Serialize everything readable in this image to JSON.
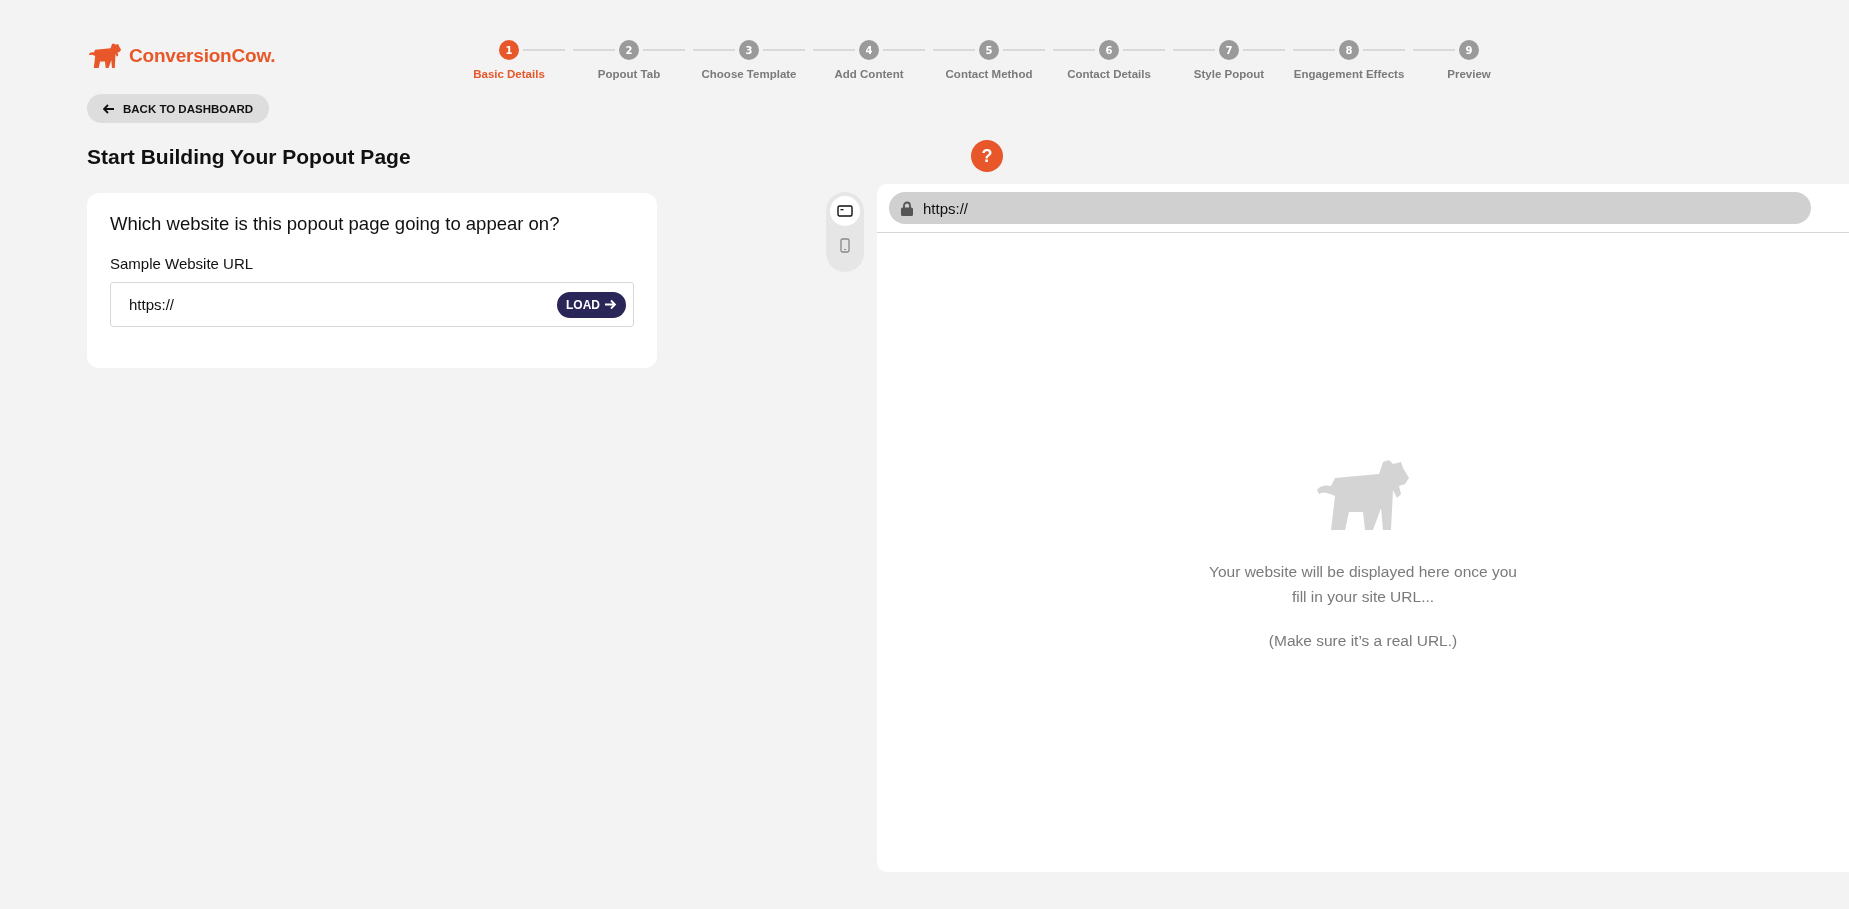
{
  "brand": {
    "name": "ConversionCow."
  },
  "steps": [
    {
      "number": "1",
      "label": "Basic Details",
      "selected": true
    },
    {
      "number": "2",
      "label": "Popout Tab",
      "selected": false
    },
    {
      "number": "3",
      "label": "Choose Template",
      "selected": false
    },
    {
      "number": "4",
      "label": "Add Content",
      "selected": false
    },
    {
      "number": "5",
      "label": "Contact Method",
      "selected": false
    },
    {
      "number": "6",
      "label": "Contact Details",
      "selected": false
    },
    {
      "number": "7",
      "label": "Style Popout",
      "selected": false
    },
    {
      "number": "8",
      "label": "Engagement Effects",
      "selected": false
    },
    {
      "number": "9",
      "label": "Preview",
      "selected": false
    }
  ],
  "back_button": {
    "label": "BACK TO DASHBOARD"
  },
  "page_title": "Start Building Your Popout Page",
  "card": {
    "question": "Which website is this popout page going to appear on?",
    "field_label": "Sample Website URL",
    "field_value": "https://",
    "load_button": "LOAD"
  },
  "help_button": {
    "label": "?"
  },
  "devices": [
    {
      "kind": "desktop",
      "selected": true
    },
    {
      "kind": "mobile",
      "selected": false
    }
  ],
  "preview": {
    "address": "https://",
    "message": "Your website will be displayed here once you fill in your site URL...",
    "note": "(Make sure it’s a real URL.)"
  }
}
